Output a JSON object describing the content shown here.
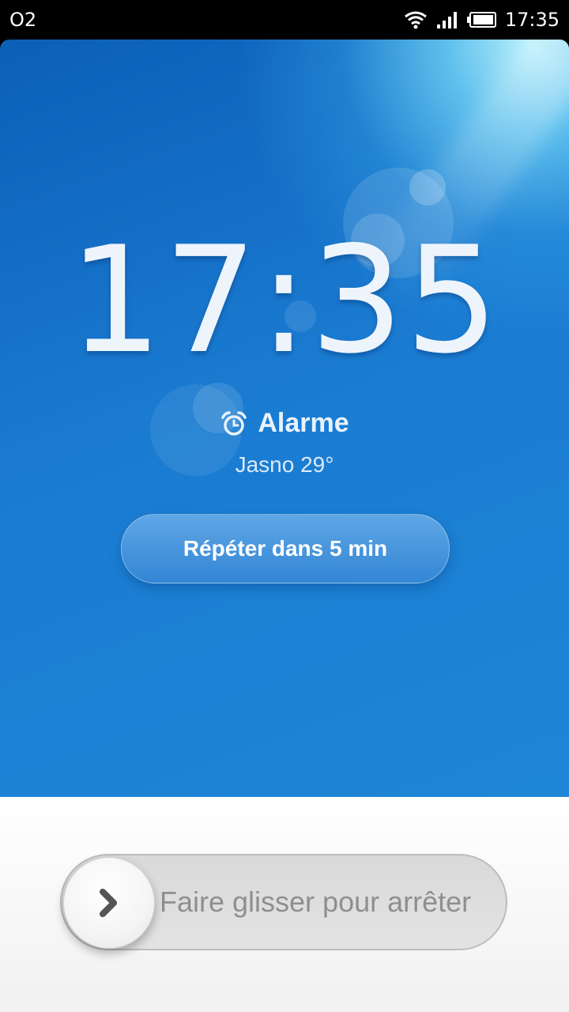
{
  "status_bar": {
    "carrier": "O2",
    "time": "17:35",
    "icons": [
      "wifi-icon",
      "signal-icon",
      "battery-icon"
    ]
  },
  "alarm": {
    "time": "17:35",
    "label": "Alarme",
    "weather": "Jasno 29°",
    "snooze_label": "Répéter dans 5 min",
    "icon": "alarm-clock-icon"
  },
  "dismiss": {
    "slider_text": "Faire glisser pour arrêter",
    "knob_icon": "chevron-right-icon"
  },
  "colors": {
    "accent": "#1a7bd1",
    "slider_text": "#8f8f8f"
  }
}
